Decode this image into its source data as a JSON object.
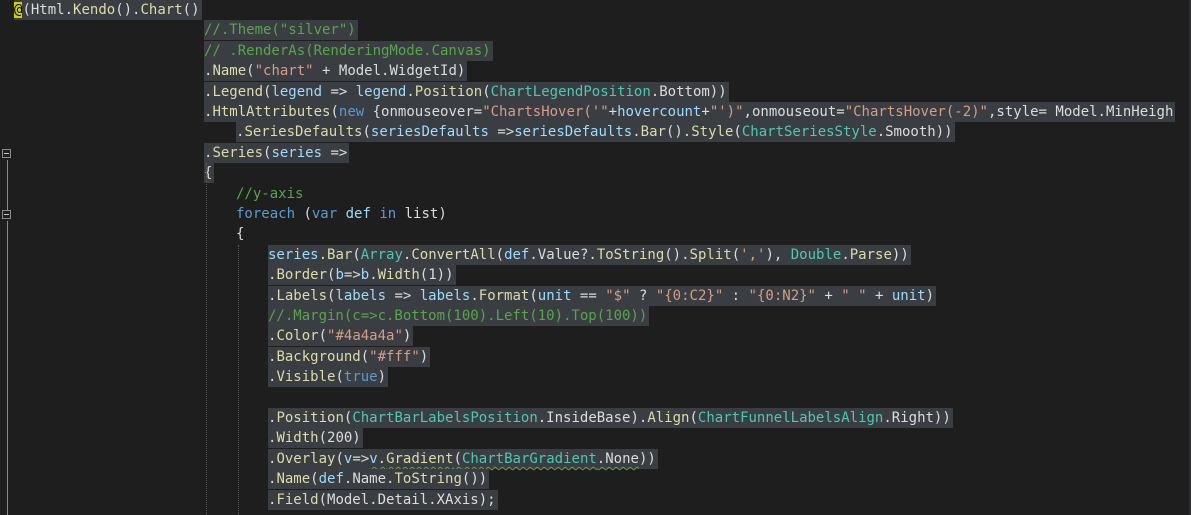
{
  "editor": {
    "colors": {
      "background": "#1e1e1e",
      "selection": "#3a3d41",
      "default": "#dcdcdc",
      "method": "#dcdcaa",
      "string": "#d69d85",
      "comment": "#57a64a",
      "keyword": "#569cd6",
      "type": "#4ec9b0",
      "param": "#9cdcfe",
      "razor": "#ffff00"
    },
    "lines": [
      {
        "indent": 0,
        "tokens": [
          {
            "t": "@",
            "c": "razor"
          },
          {
            "t": "(",
            "c": "default"
          },
          {
            "t": "Html",
            "c": "default"
          },
          {
            "t": ".",
            "c": "default"
          },
          {
            "t": "Kendo",
            "c": "method"
          },
          {
            "t": "().",
            "c": "default"
          },
          {
            "t": "Chart",
            "c": "method"
          },
          {
            "t": "()",
            "c": "default"
          }
        ]
      },
      {
        "indent": 1,
        "tokens": [
          {
            "t": "//.Theme(\"silver\")",
            "c": "comment"
          }
        ]
      },
      {
        "indent": 1,
        "tokens": [
          {
            "t": "// .RenderAs(RenderingMode.Canvas)",
            "c": "comment"
          }
        ]
      },
      {
        "indent": 1,
        "tokens": [
          {
            "t": ".",
            "c": "default"
          },
          {
            "t": "Name",
            "c": "method"
          },
          {
            "t": "(",
            "c": "default"
          },
          {
            "t": "\"chart\"",
            "c": "string"
          },
          {
            "t": " + Model.WidgetId)",
            "c": "default"
          }
        ]
      },
      {
        "indent": 1,
        "tokens": [
          {
            "t": ".",
            "c": "default"
          },
          {
            "t": "Legend",
            "c": "method"
          },
          {
            "t": "(",
            "c": "default"
          },
          {
            "t": "legend",
            "c": "param"
          },
          {
            "t": " => ",
            "c": "default"
          },
          {
            "t": "legend",
            "c": "param"
          },
          {
            "t": ".",
            "c": "default"
          },
          {
            "t": "Position",
            "c": "method"
          },
          {
            "t": "(",
            "c": "default"
          },
          {
            "t": "ChartLegendPosition",
            "c": "type"
          },
          {
            "t": ".Bottom))",
            "c": "default"
          }
        ]
      },
      {
        "indent": 1,
        "tokens": [
          {
            "t": ".",
            "c": "default"
          },
          {
            "t": "HtmlAttributes",
            "c": "method"
          },
          {
            "t": "(",
            "c": "default"
          },
          {
            "t": "new",
            "c": "keyword"
          },
          {
            "t": " {onmouseover=",
            "c": "default"
          },
          {
            "t": "\"ChartsHover('\"",
            "c": "string"
          },
          {
            "t": "+",
            "c": "default"
          },
          {
            "t": "hovercount",
            "c": "param"
          },
          {
            "t": "+",
            "c": "default"
          },
          {
            "t": "\"')\"",
            "c": "string"
          },
          {
            "t": ",onmouseout=",
            "c": "default"
          },
          {
            "t": "\"ChartsHover(-2)\"",
            "c": "string"
          },
          {
            "t": ",style= Model.MinHeigh",
            "c": "default"
          }
        ]
      },
      {
        "indent": 2,
        "tokens": [
          {
            "t": ".",
            "c": "default"
          },
          {
            "t": "SeriesDefaults",
            "c": "method"
          },
          {
            "t": "(",
            "c": "default"
          },
          {
            "t": "seriesDefaults",
            "c": "param"
          },
          {
            "t": " =>",
            "c": "default"
          },
          {
            "t": "seriesDefaults",
            "c": "param"
          },
          {
            "t": ".",
            "c": "default"
          },
          {
            "t": "Bar",
            "c": "method"
          },
          {
            "t": "().",
            "c": "default"
          },
          {
            "t": "Style",
            "c": "method"
          },
          {
            "t": "(",
            "c": "default"
          },
          {
            "t": "ChartSeriesStyle",
            "c": "type"
          },
          {
            "t": ".Smooth))",
            "c": "default"
          }
        ]
      },
      {
        "indent": 1,
        "tokens": [
          {
            "t": ".",
            "c": "default"
          },
          {
            "t": "Series",
            "c": "method"
          },
          {
            "t": "(",
            "c": "default"
          },
          {
            "t": "series",
            "c": "param"
          },
          {
            "t": " =>",
            "c": "default"
          }
        ]
      },
      {
        "indent": 1,
        "tokens": [
          {
            "t": "{",
            "c": "default"
          }
        ]
      },
      {
        "indent": 2,
        "clear": true,
        "tokens": [
          {
            "t": "//y-axis",
            "c": "comment"
          }
        ]
      },
      {
        "indent": 2,
        "clear": true,
        "tokens": [
          {
            "t": "foreach",
            "c": "keyword"
          },
          {
            "t": " (",
            "c": "default"
          },
          {
            "t": "var",
            "c": "keyword"
          },
          {
            "t": " ",
            "c": "default"
          },
          {
            "t": "def",
            "c": "param"
          },
          {
            "t": " ",
            "c": "default"
          },
          {
            "t": "in",
            "c": "keyword"
          },
          {
            "t": " list)",
            "c": "default"
          }
        ]
      },
      {
        "indent": 2,
        "clear": true,
        "tokens": [
          {
            "t": "{",
            "c": "default"
          }
        ]
      },
      {
        "indent": 3,
        "tokens": [
          {
            "t": "series",
            "c": "param"
          },
          {
            "t": ".",
            "c": "default"
          },
          {
            "t": "Bar",
            "c": "method"
          },
          {
            "t": "(",
            "c": "default"
          },
          {
            "t": "Array",
            "c": "type"
          },
          {
            "t": ".",
            "c": "default"
          },
          {
            "t": "ConvertAll",
            "c": "method"
          },
          {
            "t": "(",
            "c": "default"
          },
          {
            "t": "def",
            "c": "param"
          },
          {
            "t": ".Value?.",
            "c": "default"
          },
          {
            "t": "ToString",
            "c": "method"
          },
          {
            "t": "().",
            "c": "default"
          },
          {
            "t": "Split",
            "c": "method"
          },
          {
            "t": "(",
            "c": "default"
          },
          {
            "t": "','",
            "c": "string"
          },
          {
            "t": "), ",
            "c": "default"
          },
          {
            "t": "Double",
            "c": "type"
          },
          {
            "t": ".",
            "c": "default"
          },
          {
            "t": "Parse",
            "c": "method"
          },
          {
            "t": "))",
            "c": "default"
          }
        ]
      },
      {
        "indent": 3,
        "tokens": [
          {
            "t": ".",
            "c": "default"
          },
          {
            "t": "Border",
            "c": "method"
          },
          {
            "t": "(",
            "c": "default"
          },
          {
            "t": "b",
            "c": "param"
          },
          {
            "t": "=>",
            "c": "default"
          },
          {
            "t": "b",
            "c": "param"
          },
          {
            "t": ".",
            "c": "default"
          },
          {
            "t": "Width",
            "c": "method"
          },
          {
            "t": "(1))",
            "c": "default"
          }
        ]
      },
      {
        "indent": 3,
        "tokens": [
          {
            "t": ".",
            "c": "default"
          },
          {
            "t": "Labels",
            "c": "method"
          },
          {
            "t": "(",
            "c": "default"
          },
          {
            "t": "labels",
            "c": "param"
          },
          {
            "t": " => ",
            "c": "default"
          },
          {
            "t": "labels",
            "c": "param"
          },
          {
            "t": ".",
            "c": "default"
          },
          {
            "t": "Format",
            "c": "method"
          },
          {
            "t": "(",
            "c": "default"
          },
          {
            "t": "unit",
            "c": "param"
          },
          {
            "t": " == ",
            "c": "default"
          },
          {
            "t": "\"$\"",
            "c": "string"
          },
          {
            "t": " ? ",
            "c": "default"
          },
          {
            "t": "\"{0:C2}\"",
            "c": "string"
          },
          {
            "t": " : ",
            "c": "default"
          },
          {
            "t": "\"{0:N2}\"",
            "c": "string"
          },
          {
            "t": " + ",
            "c": "default"
          },
          {
            "t": "\" \"",
            "c": "string"
          },
          {
            "t": " + ",
            "c": "default"
          },
          {
            "t": "unit",
            "c": "param"
          },
          {
            "t": ")",
            "c": "default"
          }
        ]
      },
      {
        "indent": 3,
        "tokens": [
          {
            "t": "//.Margin(c=>c.Bottom(100).Left(10).Top(100))",
            "c": "comment"
          }
        ]
      },
      {
        "indent": 3,
        "tokens": [
          {
            "t": ".",
            "c": "default"
          },
          {
            "t": "Color",
            "c": "method"
          },
          {
            "t": "(",
            "c": "default"
          },
          {
            "t": "\"#4a4a4a\"",
            "c": "string"
          },
          {
            "t": ")",
            "c": "default"
          }
        ]
      },
      {
        "indent": 3,
        "tokens": [
          {
            "t": ".",
            "c": "default"
          },
          {
            "t": "Background",
            "c": "method"
          },
          {
            "t": "(",
            "c": "default"
          },
          {
            "t": "\"#fff\"",
            "c": "string"
          },
          {
            "t": ")",
            "c": "default"
          }
        ]
      },
      {
        "indent": 3,
        "tokens": [
          {
            "t": ".",
            "c": "default"
          },
          {
            "t": "Visible",
            "c": "method"
          },
          {
            "t": "(",
            "c": "default"
          },
          {
            "t": "true",
            "c": "keyword"
          },
          {
            "t": ")",
            "c": "default"
          }
        ]
      },
      {
        "indent": 3,
        "blank": true,
        "tokens": []
      },
      {
        "indent": 3,
        "tokens": [
          {
            "t": ".",
            "c": "default"
          },
          {
            "t": "Position",
            "c": "method"
          },
          {
            "t": "(",
            "c": "default"
          },
          {
            "t": "ChartBarLabelsPosition",
            "c": "type"
          },
          {
            "t": ".InsideBase).",
            "c": "default"
          },
          {
            "t": "Align",
            "c": "method"
          },
          {
            "t": "(",
            "c": "default"
          },
          {
            "t": "ChartFunnelLabelsAlign",
            "c": "type"
          },
          {
            "t": ".Right))",
            "c": "default"
          }
        ]
      },
      {
        "indent": 3,
        "tokens": [
          {
            "t": ".",
            "c": "default"
          },
          {
            "t": "Width",
            "c": "method"
          },
          {
            "t": "(200)",
            "c": "default"
          }
        ]
      },
      {
        "indent": 3,
        "tokens": [
          {
            "t": ".",
            "c": "default"
          },
          {
            "t": "Overlay",
            "c": "method"
          },
          {
            "t": "(",
            "c": "default"
          },
          {
            "t": "v",
            "c": "param"
          },
          {
            "t": "=>",
            "c": "default"
          },
          {
            "t": "v",
            "c": "param",
            "squig": true
          },
          {
            "t": ".",
            "c": "default",
            "squig": true
          },
          {
            "t": "Gradient",
            "c": "method",
            "squig": true
          },
          {
            "t": "(",
            "c": "default",
            "squig": true
          },
          {
            "t": "ChartBarGradient",
            "c": "type",
            "squig": true
          },
          {
            "t": ".None",
            "c": "default",
            "squig": true
          },
          {
            "t": "))",
            "c": "default"
          }
        ]
      },
      {
        "indent": 3,
        "tokens": [
          {
            "t": ".",
            "c": "default"
          },
          {
            "t": "Name",
            "c": "method"
          },
          {
            "t": "(",
            "c": "default"
          },
          {
            "t": "def",
            "c": "param"
          },
          {
            "t": ".Name.",
            "c": "default"
          },
          {
            "t": "ToString",
            "c": "method"
          },
          {
            "t": "())",
            "c": "default"
          }
        ]
      },
      {
        "indent": 3,
        "tokens": [
          {
            "t": ".",
            "c": "default"
          },
          {
            "t": "Field",
            "c": "method"
          },
          {
            "t": "(Model.Detail.XAxis);",
            "c": "default"
          }
        ]
      }
    ]
  }
}
